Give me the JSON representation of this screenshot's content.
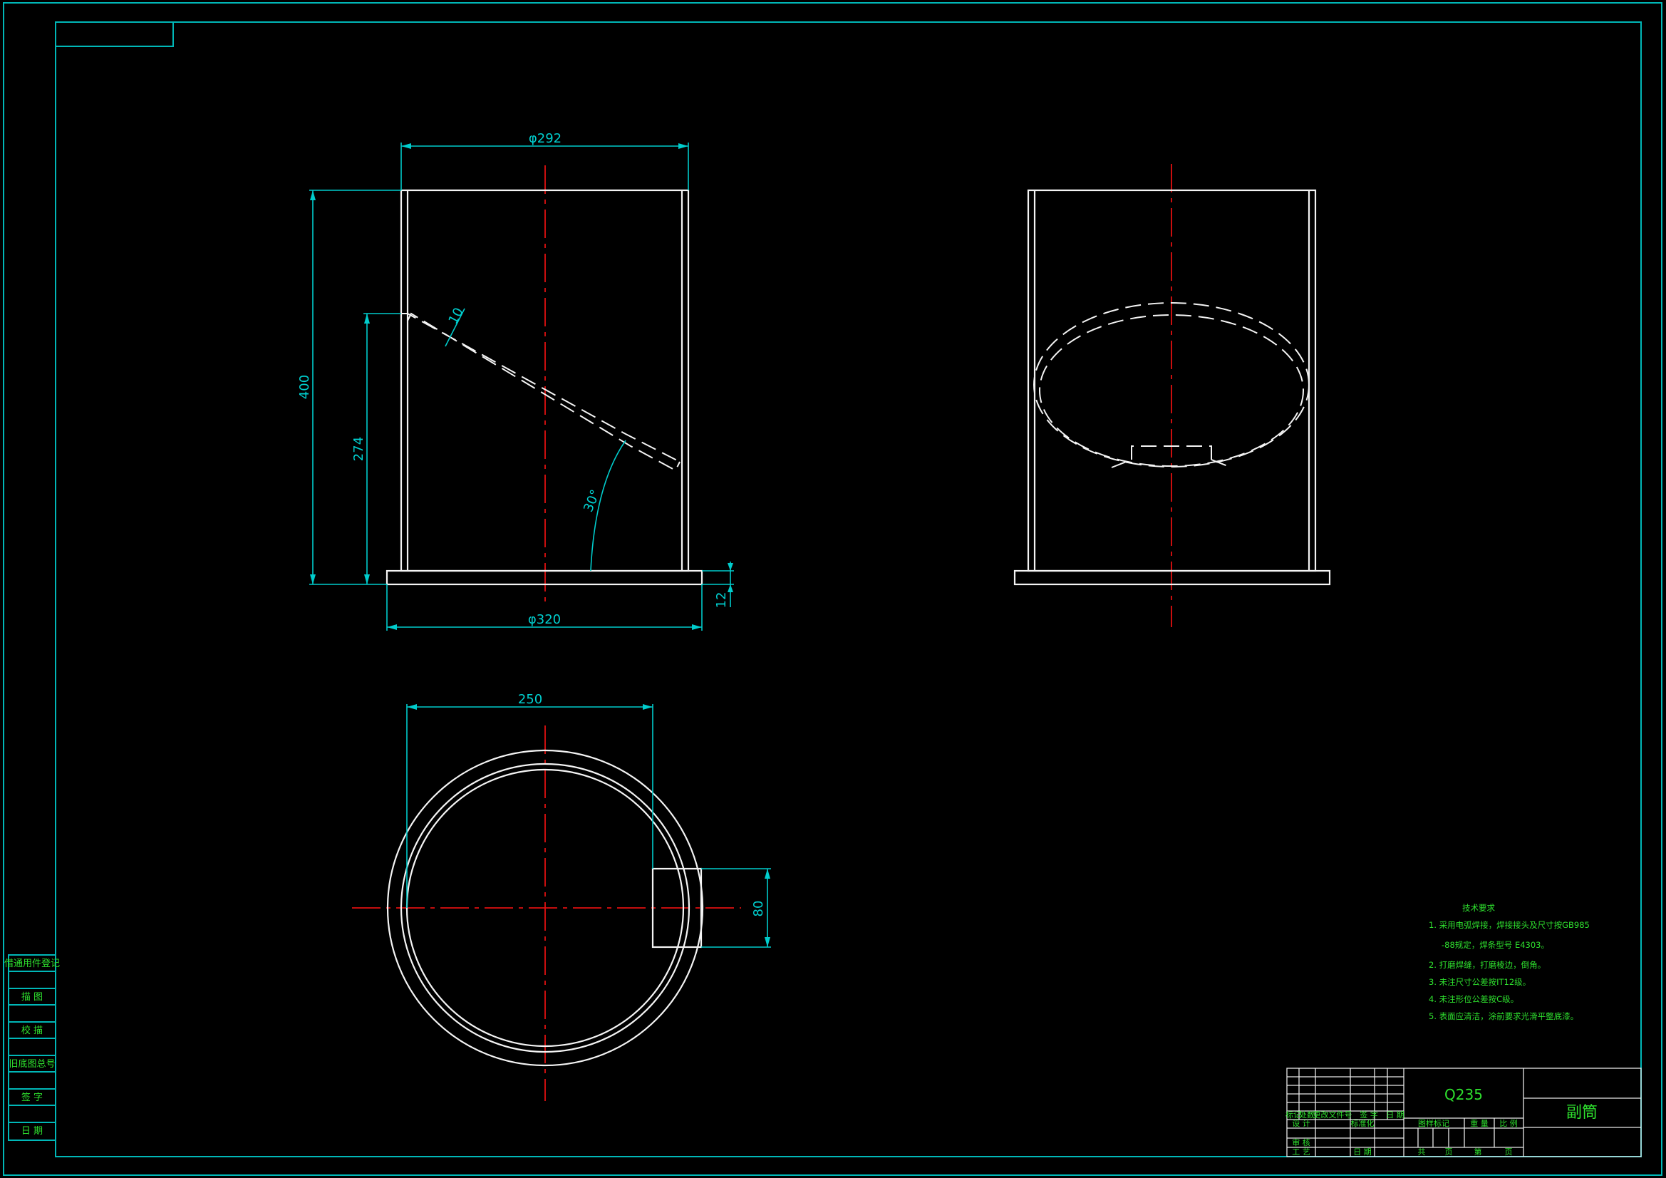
{
  "dimensions": {
    "d292": "φ292",
    "d320": "φ320",
    "h400": "400",
    "h274": "274",
    "t10": "10",
    "ang30": "30°",
    "t12": "12",
    "w250": "250",
    "w80": "80"
  },
  "side_strip": {
    "rows": [
      "借通用件登记",
      "描  图",
      "校  描",
      "旧底图总号",
      "签  字",
      "日  期"
    ]
  },
  "tech_notes": {
    "title": "技术要求",
    "lines": [
      "1. 采用电弧焊接，焊接接头及尺寸按GB985",
      "-88规定，焊条型号 E4303。",
      "2. 打磨焊缝，打磨棱边，倒角。",
      "3. 未注尺寸公差按IT12级。",
      "4. 未注形位公差按C级。",
      "5. 表面应清洁，涂前要求光滑平整底漆。"
    ]
  },
  "title_block": {
    "material": "Q235",
    "part_name": "副筒",
    "row_labels": [
      "标记",
      "处数",
      "更改文件号",
      "签 字",
      "日 期"
    ],
    "left_labels": [
      "设 计",
      "标准化",
      "审 核",
      "工 艺",
      "日 期"
    ],
    "mid_labels": [
      "图样标记",
      "重 量",
      "比 例"
    ],
    "sheet_labels": [
      "共",
      "页",
      "第",
      "页"
    ]
  },
  "colors": {
    "frame": "#00b7b7",
    "object": "#f4f4f4",
    "centerline": "#e01010",
    "dimension": "#00cccc",
    "text_green": "#2ee02e"
  }
}
